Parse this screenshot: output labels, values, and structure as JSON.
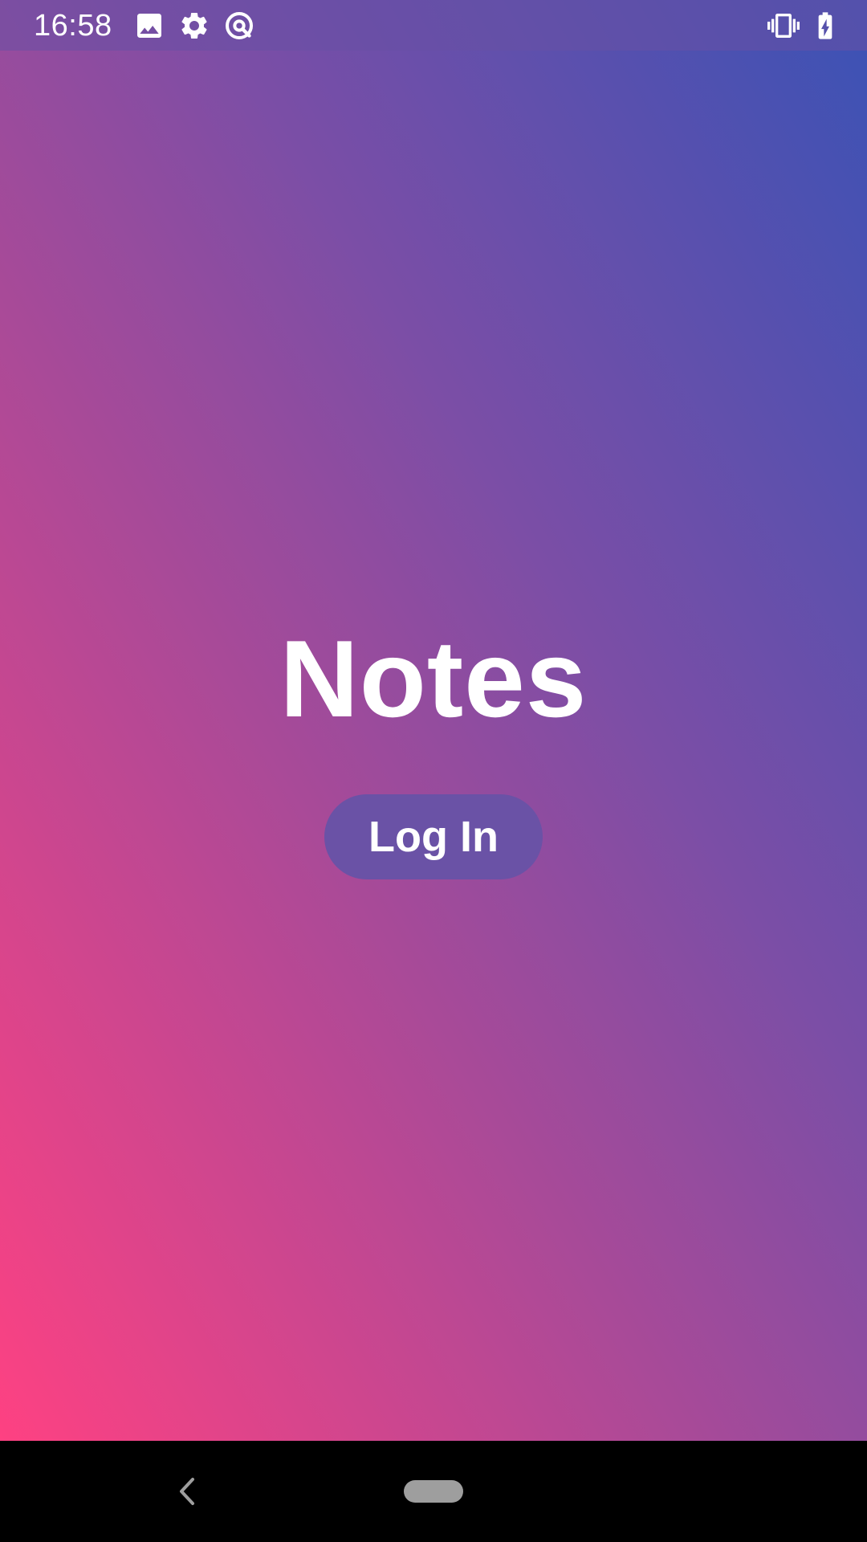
{
  "status_bar": {
    "time": "16:58",
    "icons_left": [
      "image-icon",
      "settings-gear-icon",
      "at-sync-icon"
    ],
    "icons_right": [
      "vibrate-icon",
      "battery-charging-icon"
    ]
  },
  "main": {
    "title": "Notes",
    "login_label": "Log In"
  },
  "nav_bar": {
    "icons": [
      "back-icon",
      "home-pill-icon"
    ]
  },
  "colors": {
    "gradient_bottom_left": "#fe4182",
    "gradient_top_right": "#3b52b5",
    "button_bg": "#6a52a6",
    "status_bar_bg": "#6750a4"
  }
}
